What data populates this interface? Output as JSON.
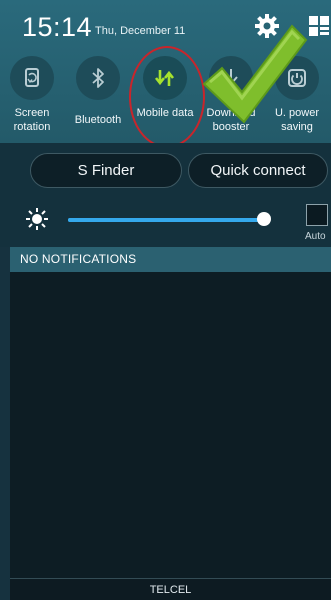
{
  "status_bar": {
    "time": "15:14",
    "date": "Thu, December 11"
  },
  "toggles": [
    {
      "label": "Screen rotation",
      "icon": "screen-rotation-icon",
      "active": false
    },
    {
      "label": "Bluetooth",
      "icon": "bluetooth-icon",
      "active": false
    },
    {
      "label": "Mobile data",
      "icon": "mobile-data-icon",
      "active": true
    },
    {
      "label": "Download booster",
      "icon": "download-booster-icon",
      "active": false
    },
    {
      "label": "U. power saving",
      "icon": "power-saving-icon",
      "active": false
    }
  ],
  "buttons": {
    "s_finder": "S Finder",
    "quick_connect": "Quick connect"
  },
  "brightness": {
    "level": 0.97,
    "auto_label": "Auto",
    "auto_checked": false
  },
  "notifications": {
    "header": "NO NOTIFICATIONS"
  },
  "carrier": "TELCEL",
  "colors": {
    "panel_top": "#2a6a7c",
    "active_icon": "#a6e22e",
    "slider": "#35a9ec",
    "annotation_circle": "#c9252b",
    "checkmark": "#7fbe2c"
  }
}
